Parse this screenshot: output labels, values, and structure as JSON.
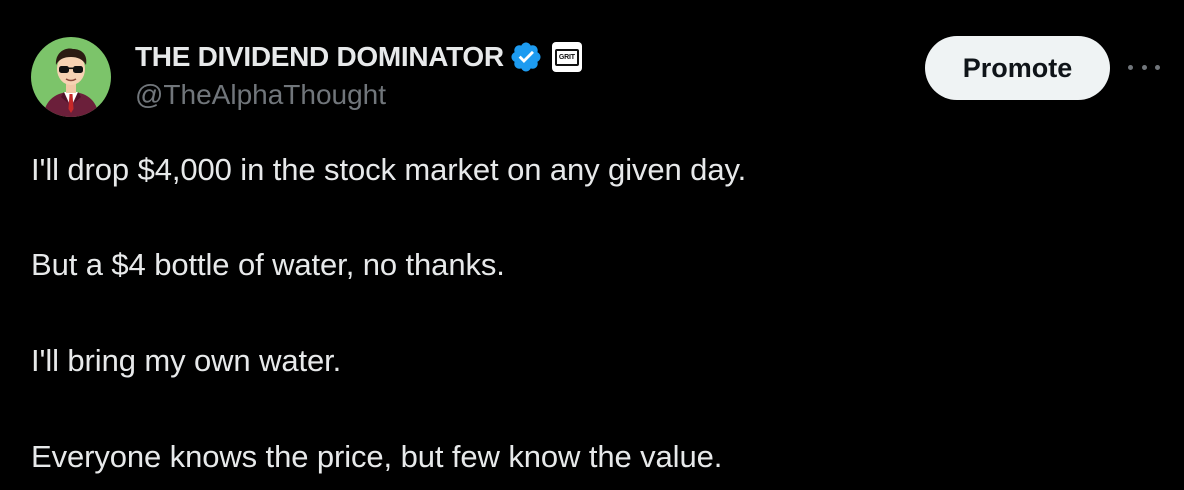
{
  "author": {
    "display_name": "THE DIVIDEND DOMINATOR",
    "handle": "@TheAlphaThought",
    "affiliate_badge_text": "GRIT",
    "verified_color": "#1d9bf0"
  },
  "actions": {
    "promote_label": "Promote",
    "more_icon": "ellipsis-icon"
  },
  "tweet": {
    "lines": [
      "I'll drop $4,000 in the stock market on any given day.",
      "But a $4 bottle of water, no thanks.",
      "I'll bring my own water.",
      "Everyone knows the price, but few know the value."
    ]
  },
  "colors": {
    "background": "#000000",
    "primary_text": "#e7e9ea",
    "secondary_text": "#71767b",
    "avatar_bg": "#7cc46a",
    "button_bg": "#eff3f4"
  }
}
